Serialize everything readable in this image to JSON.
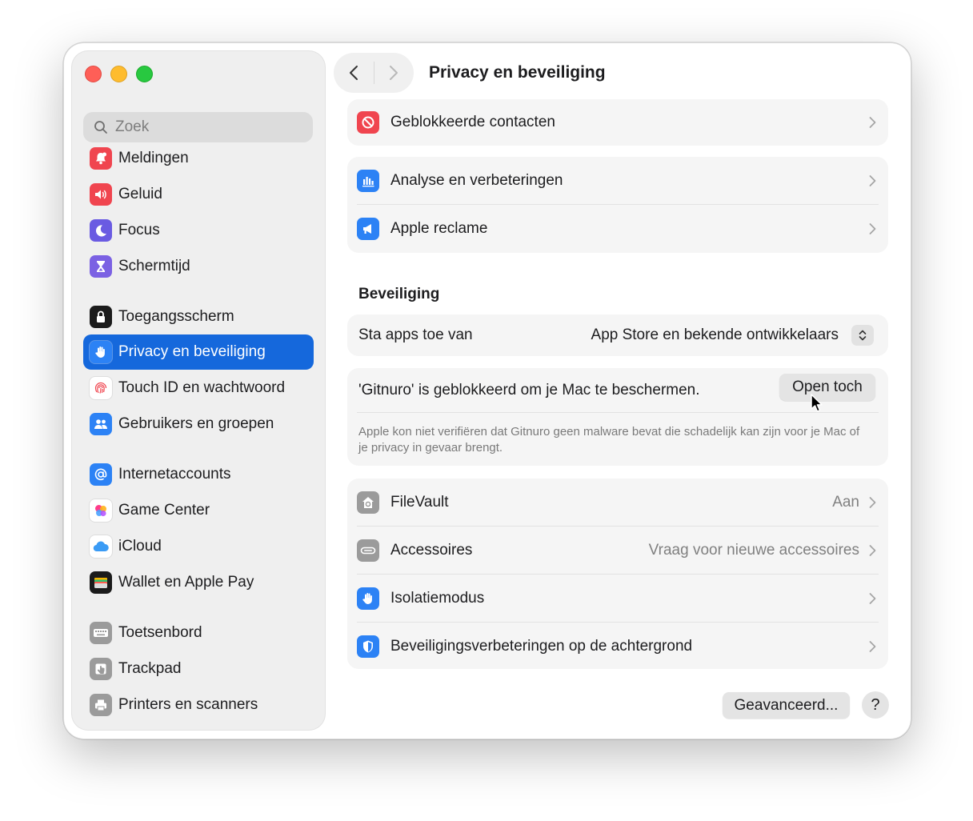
{
  "window": {
    "title": "Privacy en beveiliging"
  },
  "search": {
    "placeholder": "Zoek"
  },
  "sidebar": {
    "items": [
      {
        "label": "Meldingen",
        "icon": "bell-icon",
        "color": "#f0454f"
      },
      {
        "label": "Geluid",
        "icon": "speaker-icon",
        "color": "#f0454f"
      },
      {
        "label": "Focus",
        "icon": "moon-icon",
        "color": "#6a5be2"
      },
      {
        "label": "Schermtijd",
        "icon": "hourglass-icon",
        "color": "#7b61e3"
      },
      {
        "label": "Toegangsscherm",
        "icon": "lock-icon",
        "color": "#1b1b1b"
      },
      {
        "label": "Privacy en beveiliging",
        "icon": "hand-icon",
        "color": "#2c82f5",
        "selected": true
      },
      {
        "label": "Touch ID en wachtwoord",
        "icon": "fingerprint-icon",
        "color": "#ffffff"
      },
      {
        "label": "Gebruikers en groepen",
        "icon": "users-icon",
        "color": "#2c82f5"
      },
      {
        "label": "Internetaccounts",
        "icon": "at-icon",
        "color": "#2c82f5"
      },
      {
        "label": "Game Center",
        "icon": "game-center-icon",
        "color": "#ffffff"
      },
      {
        "label": "iCloud",
        "icon": "cloud-icon",
        "color": "#ffffff"
      },
      {
        "label": "Wallet en Apple Pay",
        "icon": "wallet-icon",
        "color": "#1b1b1b"
      },
      {
        "label": "Toetsenbord",
        "icon": "keyboard-icon",
        "color": "#9b9b9b"
      },
      {
        "label": "Trackpad",
        "icon": "trackpad-icon",
        "color": "#9b9b9b"
      },
      {
        "label": "Printers en scanners",
        "icon": "printer-icon",
        "color": "#9b9b9b"
      }
    ]
  },
  "privacy": {
    "blocked_contacts": "Geblokkeerde contacten",
    "analytics": "Analyse en verbeteringen",
    "apple_ads": "Apple reclame"
  },
  "security": {
    "title": "Beveiliging",
    "allow_apps_label": "Sta apps toe van",
    "allow_apps_value": "App Store en bekende ontwikkelaars",
    "blocked_message": "'Gitnuro' is geblokkeerd om je Mac te beschermen.",
    "open_anyway": "Open toch",
    "blocked_detail": "Apple kon niet verifiëren dat Gitnuro geen malware bevat die schadelijk kan zijn voor je Mac of je privacy in gevaar brengt.",
    "filevault": {
      "label": "FileVault",
      "value": "Aan"
    },
    "accessories": {
      "label": "Accessoires",
      "value": "Vraag voor nieuwe accessoires"
    },
    "lockdown": {
      "label": "Isolatiemodus"
    },
    "background": {
      "label": "Beveiligingsverbeteringen op de achtergrond"
    }
  },
  "footer": {
    "advanced": "Geavanceerd...",
    "help": "?"
  },
  "colors": {
    "accent": "#1568dc",
    "blocked_red": "#f0454f",
    "blue_icon": "#2c82f5",
    "gray_icon": "#9b9b9b"
  }
}
